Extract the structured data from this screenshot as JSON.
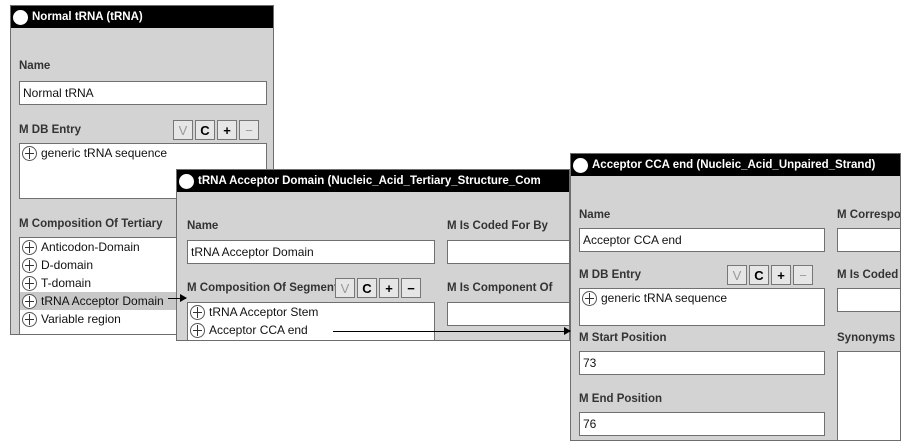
{
  "window1": {
    "title": "Normal tRNA (tRNA)",
    "name_label": "Name",
    "name_value": "Normal tRNA",
    "db_entry_label": "M DB Entry",
    "db_entry_items": [
      "generic tRNA sequence"
    ],
    "composition_label": "M Composition Of Tertiary",
    "composition_items": [
      "Anticodon-Domain",
      "D-domain",
      "T-domain",
      "tRNA Acceptor Domain",
      "Variable region"
    ],
    "buttons": {
      "view": "V",
      "create": "C",
      "add": "+",
      "remove": "−"
    }
  },
  "window2": {
    "title": "tRNA Acceptor Domain (Nucleic_Acid_Tertiary_Structure_Com",
    "name_label": "Name",
    "name_value": "tRNA Acceptor Domain",
    "coded_for_by_label": "M Is Coded For By",
    "composition_label": "M Composition Of Segments",
    "component_of_label": "M Is Component Of",
    "composition_items": [
      "tRNA Acceptor Stem",
      "Acceptor CCA end"
    ],
    "buttons": {
      "view": "V",
      "create": "C",
      "add": "+",
      "remove": "−"
    }
  },
  "window3": {
    "title": "Acceptor CCA end (Nucleic_Acid_Unpaired_Strand)",
    "name_label": "Name",
    "name_value": "Acceptor CCA end",
    "correspond_label": "M Correspo",
    "db_entry_label": "M DB Entry",
    "db_entry_items": [
      "generic tRNA sequence"
    ],
    "coded_label": "M Is Coded",
    "start_label": "M Start Position",
    "start_value": "73",
    "synonyms_label": "Synonyms",
    "end_label": "M End Position",
    "end_value": "76",
    "buttons": {
      "view": "V",
      "create": "C",
      "add": "+",
      "remove": "−"
    }
  }
}
